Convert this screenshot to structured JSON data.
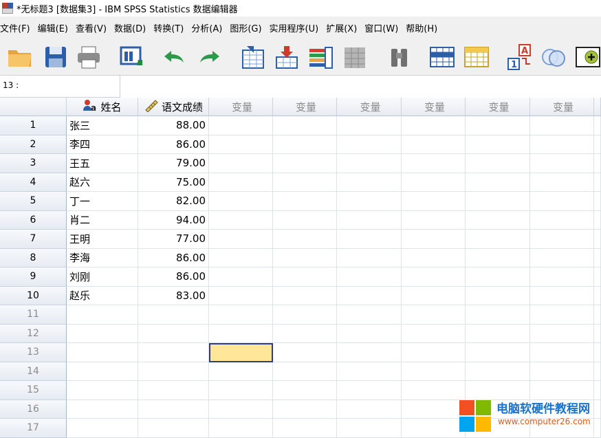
{
  "window": {
    "title": "*无标题3 [数据集3] - IBM SPSS Statistics 数据编辑器"
  },
  "menu": [
    "文件(F)",
    "编辑(E)",
    "查看(V)",
    "数据(D)",
    "转换(T)",
    "分析(A)",
    "图形(G)",
    "实用程序(U)",
    "扩展(X)",
    "窗口(W)",
    "帮助(H)"
  ],
  "toolbar": {
    "icons": [
      "open-folder-icon",
      "save-disk-icon",
      "print-icon",
      "dialog-recall-icon",
      "undo-icon",
      "redo-icon",
      "goto-case-icon",
      "goto-variable-icon",
      "variables-icon",
      "run-descriptives-icon",
      "find-icon",
      "insert-cases-icon",
      "insert-variable-icon",
      "value-labels-icon",
      "use-sets-icon",
      "add-icon"
    ]
  },
  "cellref": {
    "label": "13 :",
    "value": ""
  },
  "columns": [
    {
      "label": "姓名",
      "icon": "nominal-variable-icon",
      "type": "var"
    },
    {
      "label": "语文成绩",
      "icon": "scale-ruler-icon",
      "type": "var"
    },
    {
      "label": "变量",
      "type": "empty"
    },
    {
      "label": "变量",
      "type": "empty"
    },
    {
      "label": "变量",
      "type": "empty"
    },
    {
      "label": "变量",
      "type": "empty"
    },
    {
      "label": "变量",
      "type": "empty"
    },
    {
      "label": "变量",
      "type": "empty"
    }
  ],
  "rows": [
    {
      "n": "1",
      "name": "张三",
      "score": "88.00"
    },
    {
      "n": "2",
      "name": "李四",
      "score": "86.00"
    },
    {
      "n": "3",
      "name": "王五",
      "score": "79.00"
    },
    {
      "n": "4",
      "name": "赵六",
      "score": "75.00"
    },
    {
      "n": "5",
      "name": "丁一",
      "score": "82.00"
    },
    {
      "n": "6",
      "name": "肖二",
      "score": "94.00"
    },
    {
      "n": "7",
      "name": "王明",
      "score": "77.00"
    },
    {
      "n": "8",
      "name": "李海",
      "score": "86.00"
    },
    {
      "n": "9",
      "name": "刘刚",
      "score": "86.00"
    },
    {
      "n": "10",
      "name": "赵乐",
      "score": "83.00"
    },
    {
      "n": "11",
      "name": "",
      "score": ""
    },
    {
      "n": "12",
      "name": "",
      "score": ""
    },
    {
      "n": "13",
      "name": "",
      "score": ""
    },
    {
      "n": "14",
      "name": "",
      "score": ""
    },
    {
      "n": "15",
      "name": "",
      "score": ""
    },
    {
      "n": "16",
      "name": "",
      "score": ""
    },
    {
      "n": "17",
      "name": "",
      "score": ""
    }
  ],
  "selected_row": "13",
  "watermark": {
    "title": "电脑软硬件教程网",
    "url": "www.computer26.com"
  },
  "colors": {
    "selection": "#ffe699",
    "selection_border": "#2f3b8a",
    "watermark_title": "#1a73c9",
    "watermark_url": "#e05a12"
  }
}
